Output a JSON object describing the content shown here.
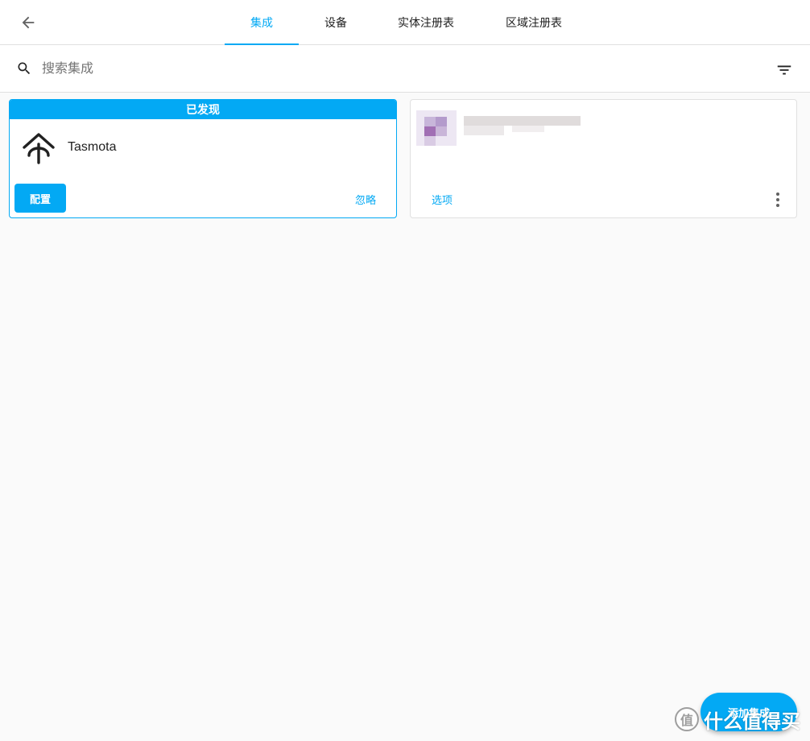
{
  "tabs": [
    {
      "label": "集成",
      "active": true
    },
    {
      "label": "设备",
      "active": false
    },
    {
      "label": "实体注册表",
      "active": false
    },
    {
      "label": "区域注册表",
      "active": false
    }
  ],
  "search": {
    "placeholder": "搜索集成"
  },
  "discovered_card": {
    "header": "已发现",
    "name": "Tasmota",
    "configure_label": "配置",
    "ignore_label": "忽略"
  },
  "configured_card": {
    "options_label": "选项"
  },
  "fab": {
    "label": "添加集成"
  },
  "watermark": {
    "badge": "值",
    "text": "什么值得买"
  },
  "colors": {
    "accent": "#03a9f4",
    "background": "#fafafa",
    "surface": "#ffffff"
  },
  "icons": [
    "back-arrow-icon",
    "search-icon",
    "filter-icon",
    "tasmota-logo-icon",
    "more-vertical-icon"
  ]
}
